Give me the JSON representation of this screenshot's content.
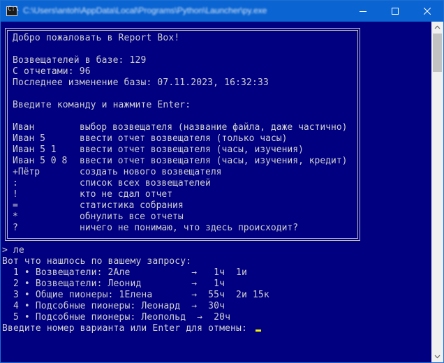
{
  "window": {
    "title": "C:\\Users\\antoh\\AppData\\Local\\Programs\\Python\\Launcher\\py.exe",
    "buttons": {
      "minimize": "minimize",
      "maximize": "maximize",
      "close": "close"
    }
  },
  "colors": {
    "background": "#000080",
    "text": "#cfcfcf",
    "cursor": "#f0f000",
    "titlebar": "#0a64d2"
  },
  "banner": {
    "welcome": "Добро пожаловать в Report Box!",
    "stats": [
      "Возвещателей в базе: 129",
      "С отчетами: 96",
      "Последнее изменение базы: 07.11.2023, 16:32:33"
    ],
    "prompt": "Введите команду и нажмите Enter:",
    "commands": [
      {
        "cmd": "Иван",
        "desc": "выбор возвещателя (название файла, даже частично)"
      },
      {
        "cmd": "Иван 5",
        "desc": "ввести отчет возвещателя (только часы)"
      },
      {
        "cmd": "Иван 5 1",
        "desc": "ввести отчет возвещателя (часы, изучения)"
      },
      {
        "cmd": "Иван 5 0 8",
        "desc": "ввести отчет возвещателя (часы, изучения, кредит)"
      },
      {
        "cmd": "+Пётр",
        "desc": "создать нового возвещателя"
      },
      {
        "cmd": ":",
        "desc": "список всех возвещателей"
      },
      {
        "cmd": "!",
        "desc": "кто не сдал отчет"
      },
      {
        "cmd": "=",
        "desc": "статистика собрания"
      },
      {
        "cmd": "*",
        "desc": "обнулить все отчеты"
      },
      {
        "cmd": "?",
        "desc": "ничего не понимаю, что здесь происходит?"
      }
    ]
  },
  "session": {
    "input": "> ле",
    "found": "Вот что нашлось по вашему запросу:",
    "results": [
      "  1 • Возвещатели: 2Але           →   1ч  1и",
      "  2 • Возвещатели: Леонид         →   1ч",
      "  3 • Общие пионеры: 1Елена       →  55ч  2и 15к",
      "  4 • Подсобные пионеры: Леонард  →  30ч",
      "  5 • Подсобные пионеры: Леопольд  →  20ч"
    ],
    "select_prompt": "Введите номер варианта или Enter для отмены: "
  }
}
